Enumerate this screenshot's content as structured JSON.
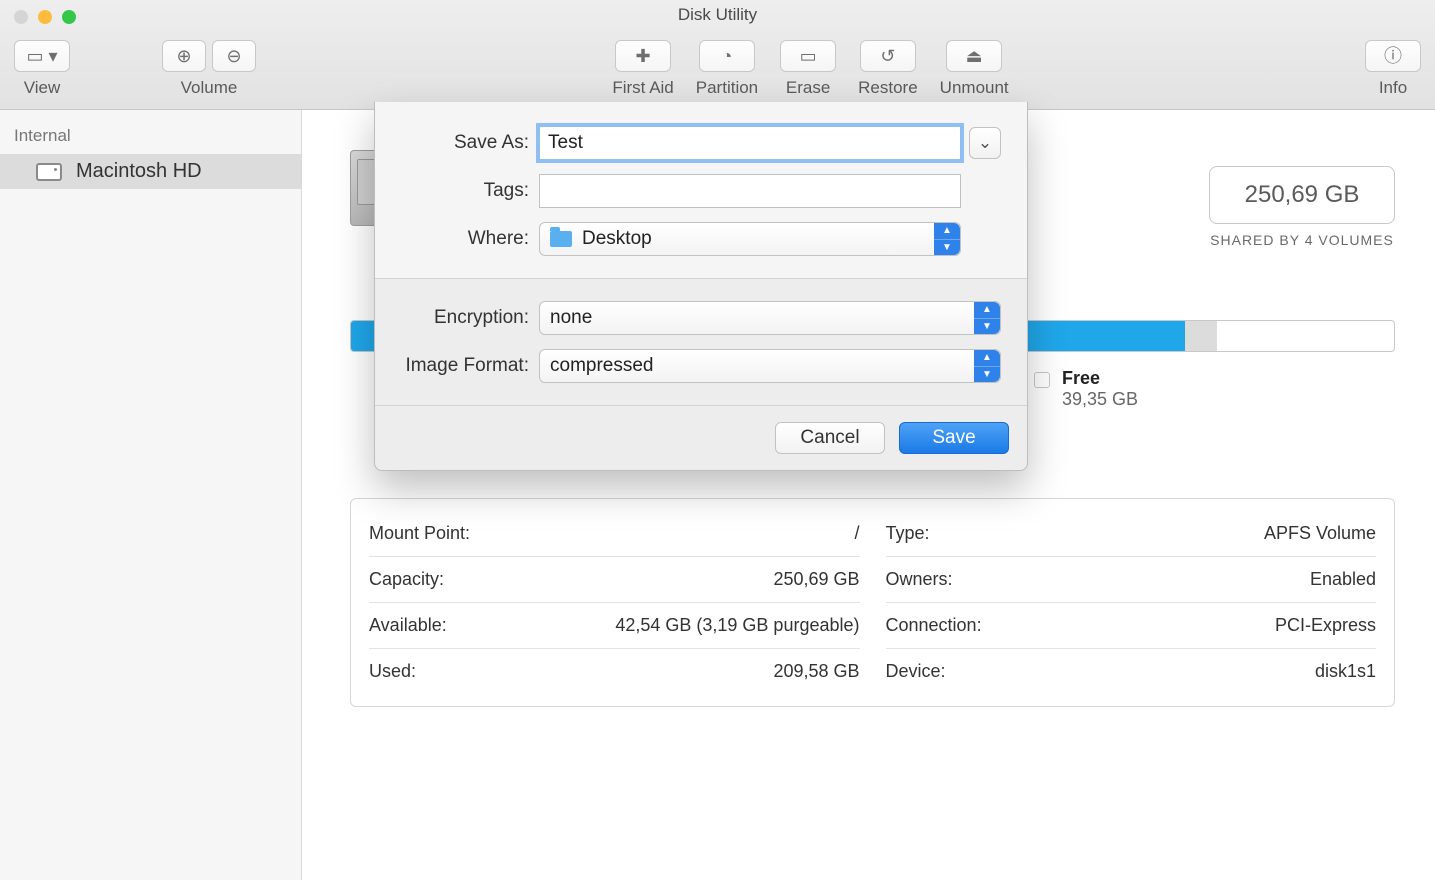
{
  "window": {
    "title": "Disk Utility"
  },
  "toolbar": {
    "view": {
      "label": "View"
    },
    "volume": {
      "label": "Volume"
    },
    "first_aid": {
      "label": "First Aid"
    },
    "partition": {
      "label": "Partition"
    },
    "erase": {
      "label": "Erase"
    },
    "restore": {
      "label": "Restore"
    },
    "unmount": {
      "label": "Unmount"
    },
    "info": {
      "label": "Info"
    }
  },
  "sidebar": {
    "section": "Internal",
    "items": [
      {
        "label": "Macintosh HD"
      }
    ]
  },
  "capacity": {
    "value": "250,69 GB",
    "sub": "SHARED BY 4 VOLUMES"
  },
  "usage": {
    "used_pct": 80,
    "other_pct": 3,
    "free": {
      "label": "Free",
      "value": "39,35 GB"
    }
  },
  "info_left": [
    {
      "label": "Mount Point:",
      "value": "/"
    },
    {
      "label": "Capacity:",
      "value": "250,69 GB"
    },
    {
      "label": "Available:",
      "value": "42,54 GB (3,19 GB purgeable)"
    },
    {
      "label": "Used:",
      "value": "209,58 GB"
    }
  ],
  "info_right": [
    {
      "label": "Type:",
      "value": "APFS Volume"
    },
    {
      "label": "Owners:",
      "value": "Enabled"
    },
    {
      "label": "Connection:",
      "value": "PCI-Express"
    },
    {
      "label": "Device:",
      "value": "disk1s1"
    }
  ],
  "sheet": {
    "save_as": {
      "label": "Save As:",
      "value": "Test"
    },
    "tags": {
      "label": "Tags:",
      "value": ""
    },
    "where": {
      "label": "Where:",
      "value": "Desktop"
    },
    "encryption": {
      "label": "Encryption:",
      "value": "none"
    },
    "format": {
      "label": "Image Format:",
      "value": "compressed"
    },
    "cancel": "Cancel",
    "save": "Save"
  }
}
